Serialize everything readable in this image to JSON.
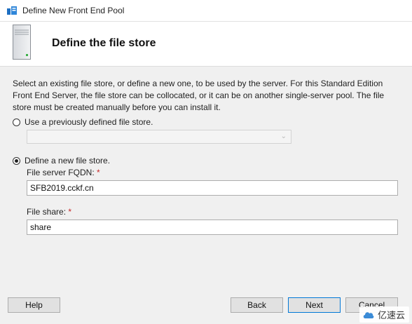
{
  "window": {
    "title": "Define New Front End Pool"
  },
  "header": {
    "title": "Define the file store"
  },
  "content": {
    "description": "Select an existing file store, or define a new one, to be used by the server. For this Standard Edition Front End Server, the file store can be collocated, or it can be on another single-server pool. The file store must be created manually before you can install it.",
    "option_existing": {
      "label": "Use a previously defined file store.",
      "selected": false,
      "dropdown_value": ""
    },
    "option_new": {
      "label": "Define a new file store.",
      "selected": true
    },
    "fqdn": {
      "label": "File server FQDN:",
      "required_mark": "*",
      "value": "SFB2019.cckf.cn"
    },
    "share": {
      "label": "File share:",
      "required_mark": "*",
      "value": "share"
    }
  },
  "footer": {
    "help_label": "Help",
    "back_label": "Back",
    "next_label": "Next",
    "cancel_label": "Cancel"
  },
  "watermark": {
    "text": "亿速云"
  },
  "colors": {
    "content_bg": "#f0f0f0",
    "required": "#c62828",
    "primary_border": "#0078d7"
  }
}
